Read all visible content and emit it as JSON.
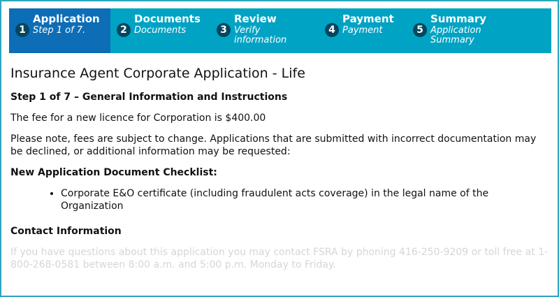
{
  "stepper": {
    "steps": [
      {
        "num": "1",
        "title": "Application",
        "sub": "Step 1 of 7.",
        "active": true
      },
      {
        "num": "2",
        "title": "Documents",
        "sub": "Documents",
        "active": false
      },
      {
        "num": "3",
        "title": "Review",
        "sub": "Verify information",
        "active": false
      },
      {
        "num": "4",
        "title": "Payment",
        "sub": "Payment",
        "active": false
      },
      {
        "num": "5",
        "title": "Summary",
        "sub": "Application Summary",
        "active": false
      }
    ]
  },
  "content": {
    "page_title": "Insurance Agent Corporate Application - Life",
    "step_heading": "Step 1 of 7 – General Information and Instructions",
    "fee_text": "The fee for a new licence for Corporation is $400.00",
    "note_text": "Please note, fees are subject to change.  Applications that are submitted with incorrect documentation may be declined, or additional information may be requested:",
    "checklist_heading": "New Application Document Checklist:",
    "checklist_items": [
      "Corporate E&O certificate (including fraudulent acts coverage) in the legal name of the Organization"
    ],
    "contact_heading": "Contact Information",
    "contact_text": "If you have questions about this application you may contact FSRA by phoning 416-250-9209 or toll free at 1-800-268-0581 between 8:00 a.m. and 5:00 p.m. Monday to Friday."
  },
  "colors": {
    "stepper_bg": "#00a3c4",
    "active_step_bg": "#0d6db6",
    "step_number_bg": "#04465e",
    "frame_border": "#2aa7bd"
  }
}
